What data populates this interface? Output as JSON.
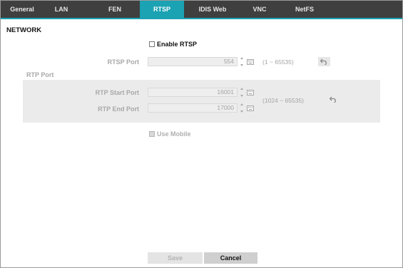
{
  "tabs": [
    {
      "label": "General",
      "active": false
    },
    {
      "label": "LAN",
      "active": false
    },
    {
      "label": "FEN",
      "active": false
    },
    {
      "label": "RTSP",
      "active": true
    },
    {
      "label": "IDIS Web",
      "active": false
    },
    {
      "label": "VNC",
      "active": false
    },
    {
      "label": "NetFS",
      "active": false
    }
  ],
  "section_title": "NETWORK",
  "enable_rtsp": {
    "label": "Enable RTSP",
    "checked": false
  },
  "rtsp_port": {
    "label": "RTSP Port",
    "value": "554",
    "range": "(1 ~ 65535)"
  },
  "rtp_port": {
    "group_label": "RTP Port",
    "start_label": "RTP Start Port",
    "start_value": "16001",
    "end_label": "RTP End Port",
    "end_value": "17000",
    "range": "(1024 ~ 65535)"
  },
  "use_mobile": {
    "label": "Use Mobile",
    "checked": false,
    "enabled": false
  },
  "buttons": {
    "save": "Save",
    "cancel": "Cancel"
  },
  "colors": {
    "accent": "#1ba2b3",
    "tabbar": "#3f3f3f"
  },
  "icons": {
    "undo": "undo-arrow-icon",
    "keyboard": "keyboard-icon",
    "stepper": "spin-stepper-icon"
  }
}
